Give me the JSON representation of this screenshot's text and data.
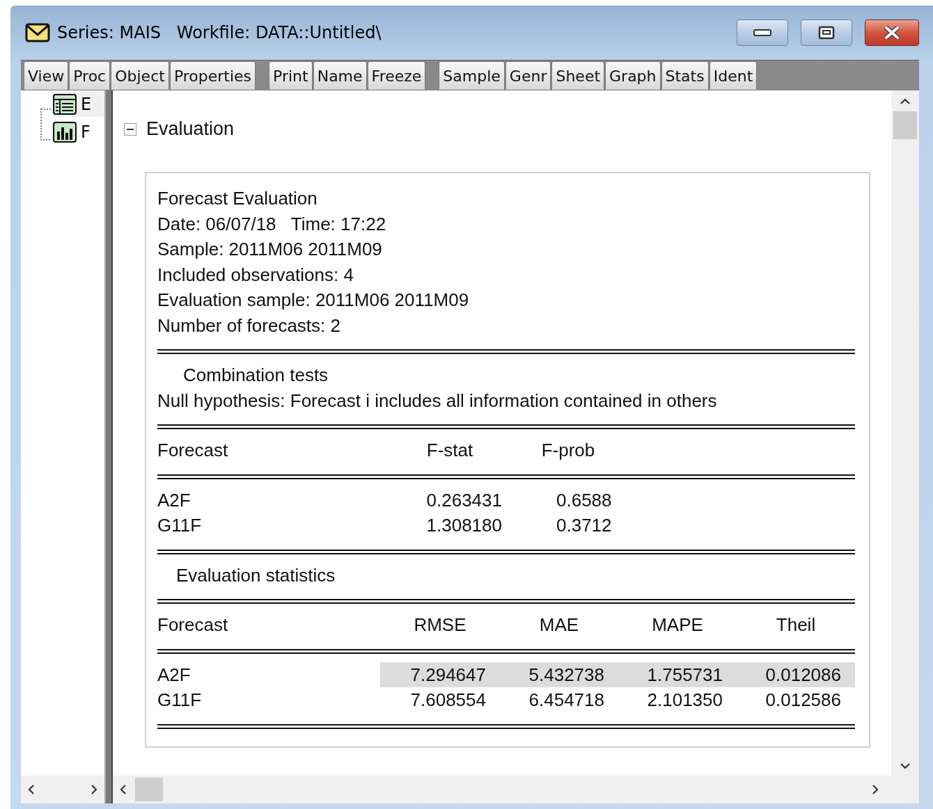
{
  "window": {
    "title": "Series: MAIS   Workfile: DATA::Untitled\\"
  },
  "toolbar": {
    "groups": [
      [
        "View",
        "Proc",
        "Object",
        "Properties"
      ],
      [
        "Print",
        "Name",
        "Freeze"
      ],
      [
        "Sample",
        "Genr",
        "Sheet",
        "Graph",
        "Stats",
        "Ident"
      ]
    ]
  },
  "tree": [
    {
      "label": "E",
      "kind": "table",
      "selected": true
    },
    {
      "label": "F",
      "kind": "graph",
      "selected": false
    }
  ],
  "section": {
    "title": "Evaluation",
    "expanded": true
  },
  "report": {
    "header_lines": [
      "Forecast Evaluation",
      "Date: 06/07/18   Time: 17:22",
      "Sample: 2011M06 2011M09",
      "Included observations: 4",
      "Evaluation sample: 2011M06 2011M09",
      "Number of forecasts: 2"
    ],
    "combination": {
      "title": "Combination tests",
      "subtitle": "Null hypothesis: Forecast i includes all information contained in others",
      "columns": [
        "Forecast",
        "F-stat",
        "F-prob"
      ],
      "rows": [
        {
          "cells": [
            "A2F",
            "0.263431",
            "0.6588"
          ]
        },
        {
          "cells": [
            "G11F",
            "1.308180",
            "0.3712"
          ]
        }
      ]
    },
    "statistics": {
      "title": "Evaluation statistics",
      "columns": [
        "Forecast",
        "RMSE",
        "MAE",
        "MAPE",
        "Theil"
      ],
      "rows": [
        {
          "cells": [
            "A2F",
            "7.294647",
            "5.432738",
            "1.755731",
            "0.012086"
          ],
          "selected": true
        },
        {
          "cells": [
            "G11F",
            "7.608554",
            "6.454718",
            "2.101350",
            "0.012586"
          ],
          "selected": false
        }
      ]
    }
  }
}
